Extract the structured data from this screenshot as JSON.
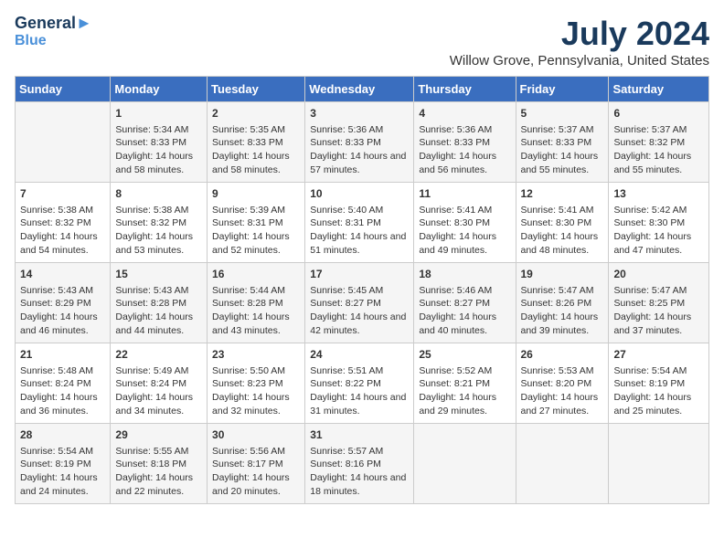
{
  "logo": {
    "line1": "General",
    "line2": "Blue"
  },
  "title": "July 2024",
  "location": "Willow Grove, Pennsylvania, United States",
  "headers": [
    "Sunday",
    "Monday",
    "Tuesday",
    "Wednesday",
    "Thursday",
    "Friday",
    "Saturday"
  ],
  "weeks": [
    [
      {
        "day": "",
        "sunrise": "",
        "sunset": "",
        "daylight": ""
      },
      {
        "day": "1",
        "sunrise": "Sunrise: 5:34 AM",
        "sunset": "Sunset: 8:33 PM",
        "daylight": "Daylight: 14 hours and 58 minutes."
      },
      {
        "day": "2",
        "sunrise": "Sunrise: 5:35 AM",
        "sunset": "Sunset: 8:33 PM",
        "daylight": "Daylight: 14 hours and 58 minutes."
      },
      {
        "day": "3",
        "sunrise": "Sunrise: 5:36 AM",
        "sunset": "Sunset: 8:33 PM",
        "daylight": "Daylight: 14 hours and 57 minutes."
      },
      {
        "day": "4",
        "sunrise": "Sunrise: 5:36 AM",
        "sunset": "Sunset: 8:33 PM",
        "daylight": "Daylight: 14 hours and 56 minutes."
      },
      {
        "day": "5",
        "sunrise": "Sunrise: 5:37 AM",
        "sunset": "Sunset: 8:33 PM",
        "daylight": "Daylight: 14 hours and 55 minutes."
      },
      {
        "day": "6",
        "sunrise": "Sunrise: 5:37 AM",
        "sunset": "Sunset: 8:32 PM",
        "daylight": "Daylight: 14 hours and 55 minutes."
      }
    ],
    [
      {
        "day": "7",
        "sunrise": "Sunrise: 5:38 AM",
        "sunset": "Sunset: 8:32 PM",
        "daylight": "Daylight: 14 hours and 54 minutes."
      },
      {
        "day": "8",
        "sunrise": "Sunrise: 5:38 AM",
        "sunset": "Sunset: 8:32 PM",
        "daylight": "Daylight: 14 hours and 53 minutes."
      },
      {
        "day": "9",
        "sunrise": "Sunrise: 5:39 AM",
        "sunset": "Sunset: 8:31 PM",
        "daylight": "Daylight: 14 hours and 52 minutes."
      },
      {
        "day": "10",
        "sunrise": "Sunrise: 5:40 AM",
        "sunset": "Sunset: 8:31 PM",
        "daylight": "Daylight: 14 hours and 51 minutes."
      },
      {
        "day": "11",
        "sunrise": "Sunrise: 5:41 AM",
        "sunset": "Sunset: 8:30 PM",
        "daylight": "Daylight: 14 hours and 49 minutes."
      },
      {
        "day": "12",
        "sunrise": "Sunrise: 5:41 AM",
        "sunset": "Sunset: 8:30 PM",
        "daylight": "Daylight: 14 hours and 48 minutes."
      },
      {
        "day": "13",
        "sunrise": "Sunrise: 5:42 AM",
        "sunset": "Sunset: 8:30 PM",
        "daylight": "Daylight: 14 hours and 47 minutes."
      }
    ],
    [
      {
        "day": "14",
        "sunrise": "Sunrise: 5:43 AM",
        "sunset": "Sunset: 8:29 PM",
        "daylight": "Daylight: 14 hours and 46 minutes."
      },
      {
        "day": "15",
        "sunrise": "Sunrise: 5:43 AM",
        "sunset": "Sunset: 8:28 PM",
        "daylight": "Daylight: 14 hours and 44 minutes."
      },
      {
        "day": "16",
        "sunrise": "Sunrise: 5:44 AM",
        "sunset": "Sunset: 8:28 PM",
        "daylight": "Daylight: 14 hours and 43 minutes."
      },
      {
        "day": "17",
        "sunrise": "Sunrise: 5:45 AM",
        "sunset": "Sunset: 8:27 PM",
        "daylight": "Daylight: 14 hours and 42 minutes."
      },
      {
        "day": "18",
        "sunrise": "Sunrise: 5:46 AM",
        "sunset": "Sunset: 8:27 PM",
        "daylight": "Daylight: 14 hours and 40 minutes."
      },
      {
        "day": "19",
        "sunrise": "Sunrise: 5:47 AM",
        "sunset": "Sunset: 8:26 PM",
        "daylight": "Daylight: 14 hours and 39 minutes."
      },
      {
        "day": "20",
        "sunrise": "Sunrise: 5:47 AM",
        "sunset": "Sunset: 8:25 PM",
        "daylight": "Daylight: 14 hours and 37 minutes."
      }
    ],
    [
      {
        "day": "21",
        "sunrise": "Sunrise: 5:48 AM",
        "sunset": "Sunset: 8:24 PM",
        "daylight": "Daylight: 14 hours and 36 minutes."
      },
      {
        "day": "22",
        "sunrise": "Sunrise: 5:49 AM",
        "sunset": "Sunset: 8:24 PM",
        "daylight": "Daylight: 14 hours and 34 minutes."
      },
      {
        "day": "23",
        "sunrise": "Sunrise: 5:50 AM",
        "sunset": "Sunset: 8:23 PM",
        "daylight": "Daylight: 14 hours and 32 minutes."
      },
      {
        "day": "24",
        "sunrise": "Sunrise: 5:51 AM",
        "sunset": "Sunset: 8:22 PM",
        "daylight": "Daylight: 14 hours and 31 minutes."
      },
      {
        "day": "25",
        "sunrise": "Sunrise: 5:52 AM",
        "sunset": "Sunset: 8:21 PM",
        "daylight": "Daylight: 14 hours and 29 minutes."
      },
      {
        "day": "26",
        "sunrise": "Sunrise: 5:53 AM",
        "sunset": "Sunset: 8:20 PM",
        "daylight": "Daylight: 14 hours and 27 minutes."
      },
      {
        "day": "27",
        "sunrise": "Sunrise: 5:54 AM",
        "sunset": "Sunset: 8:19 PM",
        "daylight": "Daylight: 14 hours and 25 minutes."
      }
    ],
    [
      {
        "day": "28",
        "sunrise": "Sunrise: 5:54 AM",
        "sunset": "Sunset: 8:19 PM",
        "daylight": "Daylight: 14 hours and 24 minutes."
      },
      {
        "day": "29",
        "sunrise": "Sunrise: 5:55 AM",
        "sunset": "Sunset: 8:18 PM",
        "daylight": "Daylight: 14 hours and 22 minutes."
      },
      {
        "day": "30",
        "sunrise": "Sunrise: 5:56 AM",
        "sunset": "Sunset: 8:17 PM",
        "daylight": "Daylight: 14 hours and 20 minutes."
      },
      {
        "day": "31",
        "sunrise": "Sunrise: 5:57 AM",
        "sunset": "Sunset: 8:16 PM",
        "daylight": "Daylight: 14 hours and 18 minutes."
      },
      {
        "day": "",
        "sunrise": "",
        "sunset": "",
        "daylight": ""
      },
      {
        "day": "",
        "sunrise": "",
        "sunset": "",
        "daylight": ""
      },
      {
        "day": "",
        "sunrise": "",
        "sunset": "",
        "daylight": ""
      }
    ]
  ]
}
